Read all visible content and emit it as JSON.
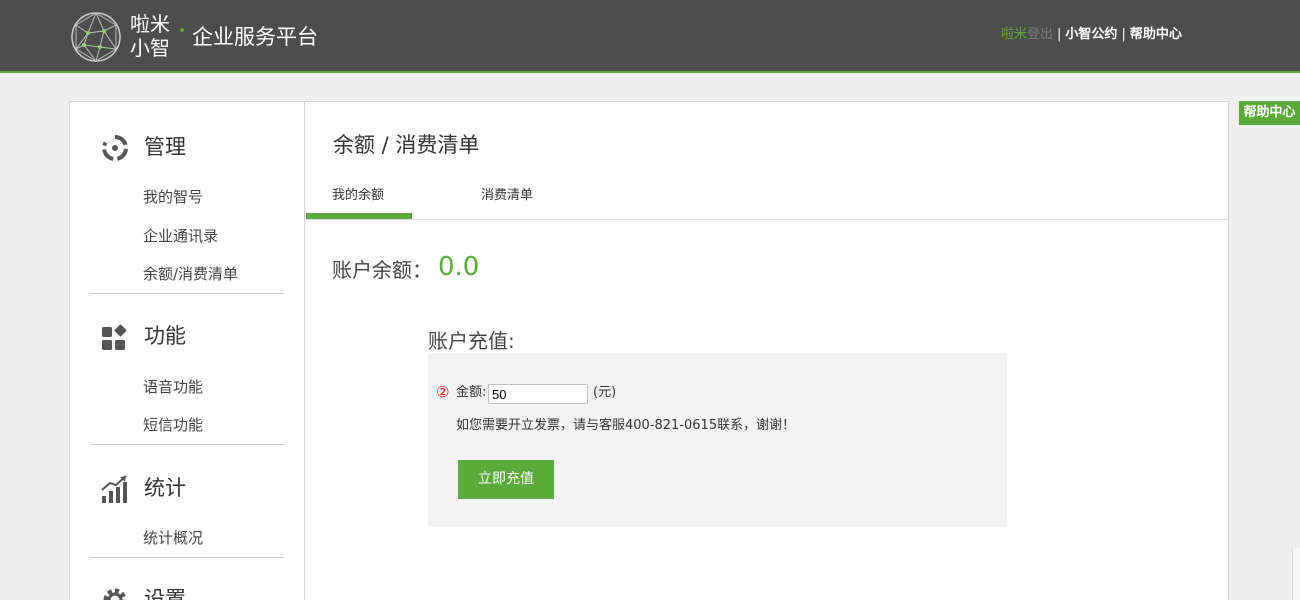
{
  "header": {
    "logo": {
      "text": "啦米小智",
      "icon": "geodesic-sphere-icon"
    },
    "brand_subtitle": "企业服务平台",
    "user_name": "啦米",
    "logout_label": "登出",
    "sep": "|",
    "link_convention": "小智公约",
    "link_help": "帮助中心"
  },
  "float_help": "帮助中心",
  "sidebar": {
    "sections": [
      {
        "title": "管理",
        "icon": "manage-icon",
        "items": [
          "我的智号",
          "企业通讯录",
          "余额/消费清单"
        ]
      },
      {
        "title": "功能",
        "icon": "function-icon",
        "items": [
          "语音功能",
          "短信功能"
        ]
      },
      {
        "title": "统计",
        "icon": "chart-icon",
        "items": [
          "统计概况"
        ]
      },
      {
        "title": "设置",
        "icon": "gear-icon",
        "items": []
      }
    ]
  },
  "page": {
    "title": "余额 / 消费清单",
    "tabs": [
      {
        "label": "我的余额",
        "active": true
      },
      {
        "label": "消费清单",
        "active": false
      }
    ],
    "balance_label": "账户余额：",
    "balance_value": "0.0",
    "recharge": {
      "title": "账户充值:",
      "step_mark": "②",
      "amount_label": "金额:",
      "amount_value": "50",
      "unit": "(元)",
      "notice": "如您需要开立发票，请与客服400-821-0615联系，谢谢！",
      "submit_label": "立即充值"
    }
  },
  "colors": {
    "accent": "#5bab3b",
    "header_bg": "#4d4d4d",
    "page_bg": "#efefef"
  }
}
